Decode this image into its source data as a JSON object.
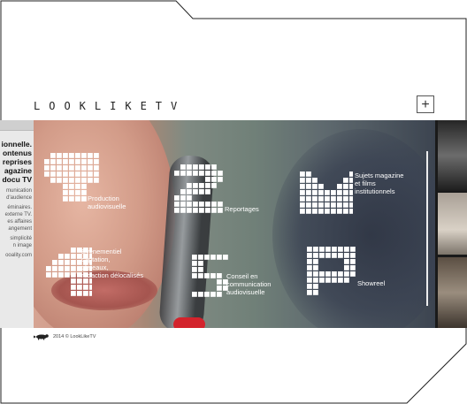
{
  "brand": {
    "name": "LOOKLIKETV"
  },
  "header": {
    "plus_symbol": "+"
  },
  "left_panel": {
    "headline": [
      "ionnelle.",
      "ontenus",
      "reprises",
      "agazine",
      "docu TV"
    ],
    "paragraph_1": [
      "munication",
      "d'audience"
    ],
    "paragraph_2": [
      "éminaires.",
      "externe TV.",
      "es affaires",
      "angement"
    ],
    "paragraph_3": [
      "simplicité",
      "n image"
    ],
    "paragraph_4": [
      "ooality.com"
    ]
  },
  "tiles": [
    {
      "label": "Production\naudiovisuelle"
    },
    {
      "label": "Reportages"
    },
    {
      "label": "Sujets magazine\net films\ninstitutionnels"
    },
    {
      "label": "Evénementiel\ncaptation,\nplateaux,\nrédaction délocalisés"
    },
    {
      "label": "Conseil en\ncommunication\naudiovisuelle"
    },
    {
      "label": "Showreel"
    }
  ],
  "footer": {
    "copyright": "2014 © LookLikeTV"
  },
  "colors": {
    "frame_stroke": "#222222",
    "mic_red": "#d3232c"
  }
}
